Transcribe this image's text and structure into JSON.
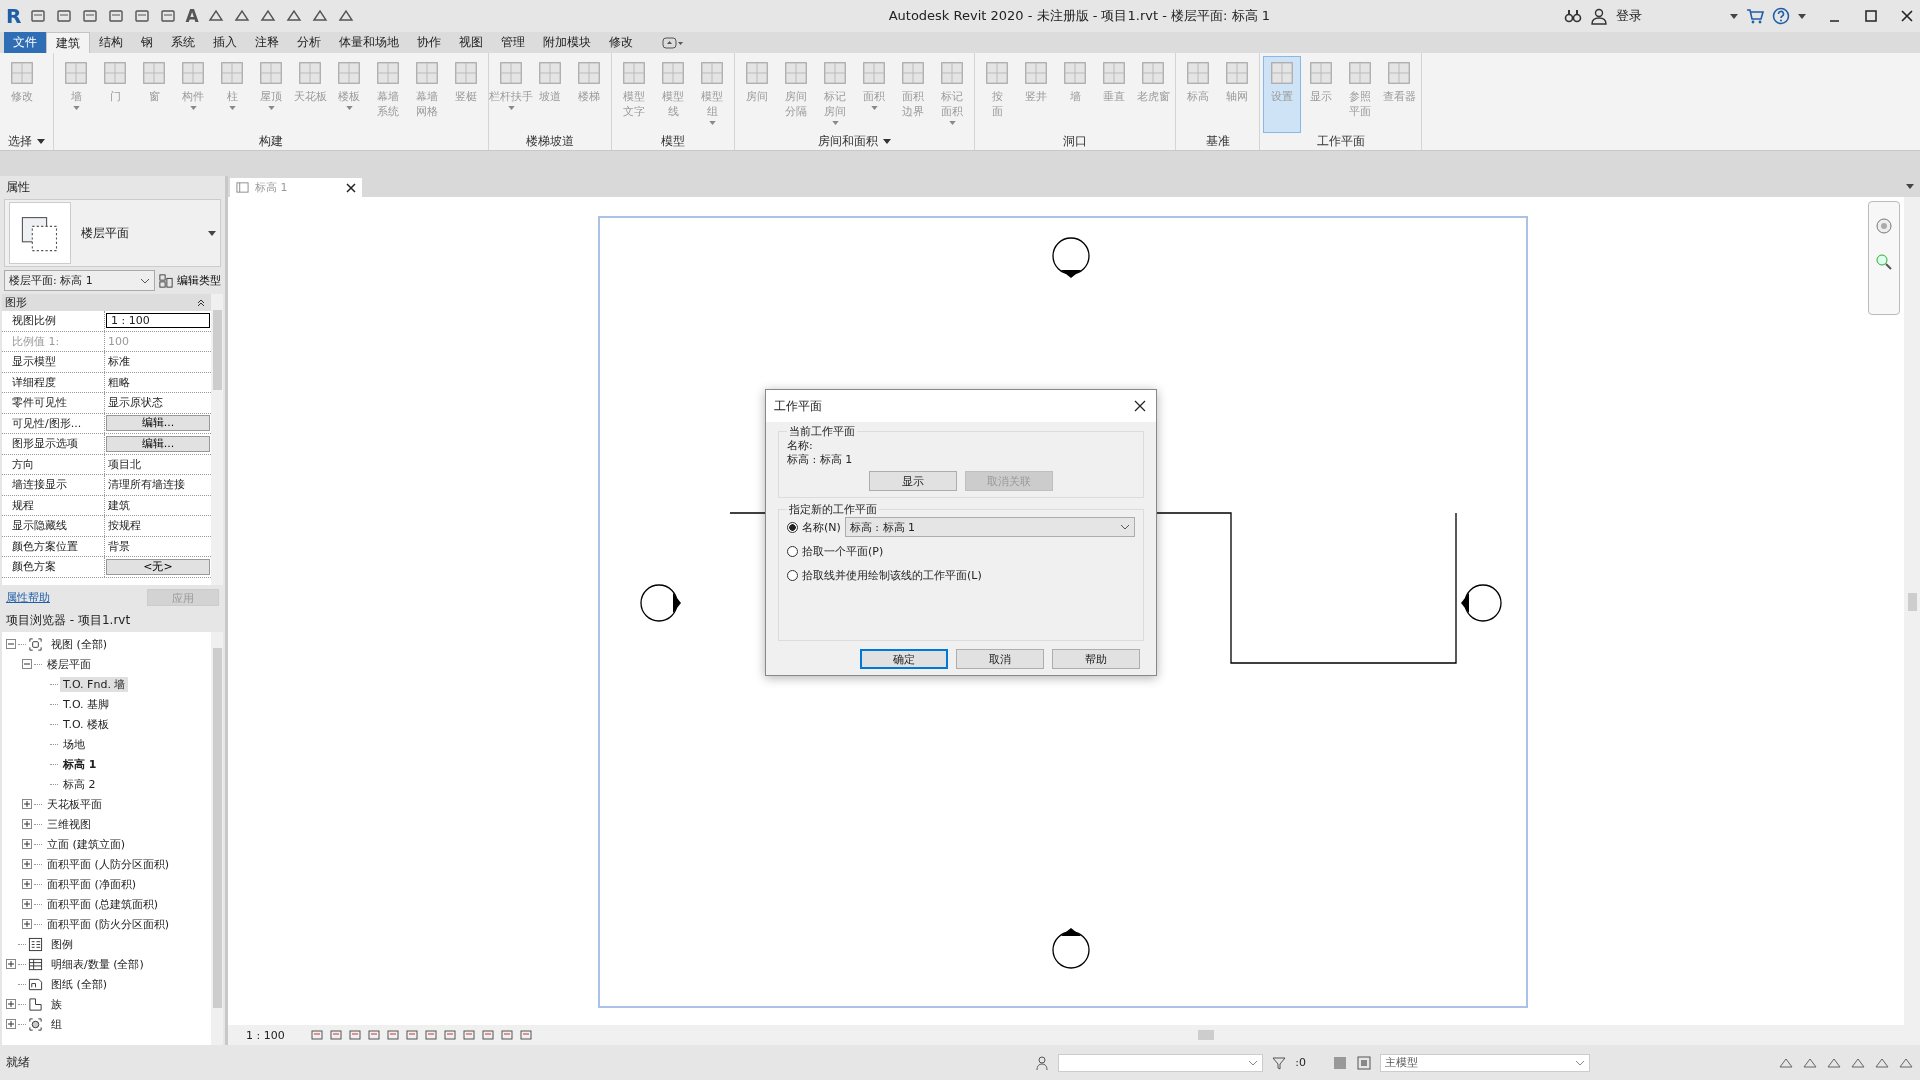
{
  "title_bar": {
    "logo": "R",
    "quick_text_tool": "A",
    "title": "Autodesk Revit 2020 - 未注册版 - 项目1.rvt - 楼层平面: 标高 1",
    "sign_in": "登录"
  },
  "menu_tabs": [
    {
      "label": "文件",
      "kind": "file",
      "selected": false
    },
    {
      "label": "建筑",
      "kind": "tab",
      "selected": true
    },
    {
      "label": "结构",
      "kind": "tab",
      "selected": false
    },
    {
      "label": "钢",
      "kind": "tab",
      "selected": false
    },
    {
      "label": "系统",
      "kind": "tab",
      "selected": false
    },
    {
      "label": "插入",
      "kind": "tab",
      "selected": false
    },
    {
      "label": "注释",
      "kind": "tab",
      "selected": false
    },
    {
      "label": "分析",
      "kind": "tab",
      "selected": false
    },
    {
      "label": "体量和场地",
      "kind": "tab",
      "selected": false
    },
    {
      "label": "协作",
      "kind": "tab",
      "selected": false
    },
    {
      "label": "视图",
      "kind": "tab",
      "selected": false
    },
    {
      "label": "管理",
      "kind": "tab",
      "selected": false
    },
    {
      "label": "附加模块",
      "kind": "tab",
      "selected": false
    },
    {
      "label": "修改",
      "kind": "tab",
      "selected": false
    }
  ],
  "ribbon": {
    "groups": [
      {
        "label": "选择",
        "dropdown": true,
        "tools": [
          {
            "lines": [
              "修改"
            ],
            "dropdown": false,
            "selected": false
          }
        ]
      },
      {
        "label": "构建",
        "dropdown": false,
        "tools": [
          {
            "lines": [
              "墙"
            ],
            "dropdown": true,
            "selected": false
          },
          {
            "lines": [
              "门"
            ],
            "dropdown": false,
            "selected": false
          },
          {
            "lines": [
              "窗"
            ],
            "dropdown": false,
            "selected": false
          },
          {
            "lines": [
              "构件"
            ],
            "dropdown": true,
            "selected": false
          },
          {
            "lines": [
              "柱"
            ],
            "dropdown": true,
            "selected": false
          },
          {
            "lines": [
              "屋顶"
            ],
            "dropdown": true,
            "selected": false
          },
          {
            "lines": [
              "天花板"
            ],
            "dropdown": false,
            "selected": false
          },
          {
            "lines": [
              "楼板"
            ],
            "dropdown": true,
            "selected": false
          },
          {
            "lines": [
              "幕墙",
              "系统"
            ],
            "dropdown": false,
            "selected": false
          },
          {
            "lines": [
              "幕墙",
              "网格"
            ],
            "dropdown": false,
            "selected": false
          },
          {
            "lines": [
              "竖梃"
            ],
            "dropdown": false,
            "selected": false
          }
        ]
      },
      {
        "label": "楼梯坡道",
        "dropdown": false,
        "tools": [
          {
            "lines": [
              "栏杆扶手"
            ],
            "dropdown": true,
            "selected": false
          },
          {
            "lines": [
              "坡道"
            ],
            "dropdown": false,
            "selected": false
          },
          {
            "lines": [
              "楼梯"
            ],
            "dropdown": false,
            "selected": false
          }
        ]
      },
      {
        "label": "模型",
        "dropdown": false,
        "tools": [
          {
            "lines": [
              "模型",
              "文字"
            ],
            "dropdown": false,
            "selected": false
          },
          {
            "lines": [
              "模型",
              "线"
            ],
            "dropdown": false,
            "selected": false
          },
          {
            "lines": [
              "模型",
              "组"
            ],
            "dropdown": true,
            "selected": false
          }
        ]
      },
      {
        "label": "房间和面积",
        "dropdown": true,
        "tools": [
          {
            "lines": [
              "房间"
            ],
            "dropdown": false,
            "selected": false
          },
          {
            "lines": [
              "房间",
              "分隔"
            ],
            "dropdown": false,
            "selected": false
          },
          {
            "lines": [
              "标记",
              "房间"
            ],
            "dropdown": true,
            "selected": false
          },
          {
            "lines": [
              "面积"
            ],
            "dropdown": true,
            "selected": false
          },
          {
            "lines": [
              "面积",
              "边界"
            ],
            "dropdown": false,
            "selected": false
          },
          {
            "lines": [
              "标记",
              "面积"
            ],
            "dropdown": true,
            "selected": false
          }
        ]
      },
      {
        "label": "洞口",
        "dropdown": false,
        "tools": [
          {
            "lines": [
              "按",
              "面"
            ],
            "dropdown": false,
            "selected": false
          },
          {
            "lines": [
              "竖井"
            ],
            "dropdown": false,
            "selected": false
          },
          {
            "lines": [
              "墙"
            ],
            "dropdown": false,
            "selected": false
          },
          {
            "lines": [
              "垂直"
            ],
            "dropdown": false,
            "selected": false
          },
          {
            "lines": [
              "老虎窗"
            ],
            "dropdown": false,
            "selected": false
          }
        ]
      },
      {
        "label": "基准",
        "dropdown": false,
        "tools": [
          {
            "lines": [
              "标高"
            ],
            "dropdown": false,
            "selected": false
          },
          {
            "lines": [
              "轴网"
            ],
            "dropdown": false,
            "selected": false
          }
        ]
      },
      {
        "label": "工作平面",
        "dropdown": false,
        "tools": [
          {
            "lines": [
              "设置"
            ],
            "dropdown": false,
            "selected": true
          },
          {
            "lines": [
              "显示"
            ],
            "dropdown": false,
            "selected": false
          },
          {
            "lines": [
              "参照",
              "平面"
            ],
            "dropdown": false,
            "selected": false
          },
          {
            "lines": [
              "查看器"
            ],
            "dropdown": false,
            "selected": false
          }
        ]
      }
    ]
  },
  "properties": {
    "title": "属性",
    "type_name": "楼层平面",
    "view_selector": "楼层平面: 标高 1",
    "edit_type": "编辑类型",
    "category": "图形",
    "rows": [
      {
        "name": "视图比例",
        "value": "1 : 100",
        "kind": "input"
      },
      {
        "name": "比例值 1:",
        "value": "100",
        "kind": "disabled"
      },
      {
        "name": "显示模型",
        "value": "标准",
        "kind": "text"
      },
      {
        "name": "详细程度",
        "value": "粗略",
        "kind": "text"
      },
      {
        "name": "零件可见性",
        "value": "显示原状态",
        "kind": "text"
      },
      {
        "name": "可见性/图形...",
        "value": "编辑...",
        "kind": "button"
      },
      {
        "name": "图形显示选项",
        "value": "编辑...",
        "kind": "button"
      },
      {
        "name": "方向",
        "value": "项目北",
        "kind": "text"
      },
      {
        "name": "墙连接显示",
        "value": "清理所有墙连接",
        "kind": "text"
      },
      {
        "name": "规程",
        "value": "建筑",
        "kind": "text"
      },
      {
        "name": "显示隐藏线",
        "value": "按规程",
        "kind": "text"
      },
      {
        "name": "颜色方案位置",
        "value": "背景",
        "kind": "text"
      },
      {
        "name": "颜色方案",
        "value": "<无>",
        "kind": "button"
      }
    ],
    "help_link": "属性帮助",
    "apply": "应用"
  },
  "project_browser": {
    "title": "项目浏览器 - 项目1.rvt",
    "tree": [
      {
        "label": "视图 (全部)",
        "kind": "views",
        "expanded": true,
        "children": [
          {
            "label": "楼层平面",
            "expanded": true,
            "children": [
              {
                "label": "T.O. Fnd. 墙",
                "selected": true,
                "current": false
              },
              {
                "label": "T.O. 基脚",
                "selected": false,
                "current": false
              },
              {
                "label": "T.O. 楼板",
                "selected": false,
                "current": false
              },
              {
                "label": "场地",
                "selected": false,
                "current": false
              },
              {
                "label": "标高 1",
                "selected": false,
                "current": true
              },
              {
                "label": "标高 2",
                "selected": false,
                "current": false
              }
            ]
          },
          {
            "label": "天花板平面",
            "expanded": false
          },
          {
            "label": "三维视图",
            "expanded": false
          },
          {
            "label": "立面 (建筑立面)",
            "expanded": false
          },
          {
            "label": "面积平面 (人防分区面积)",
            "expanded": false
          },
          {
            "label": "面积平面 (净面积)",
            "expanded": false
          },
          {
            "label": "面积平面 (总建筑面积)",
            "expanded": false
          },
          {
            "label": "面积平面 (防火分区面积)",
            "expanded": false
          }
        ]
      },
      {
        "label": "图例",
        "kind": "legend"
      },
      {
        "label": "明细表/数量 (全部)",
        "kind": "schedule",
        "expanded": false
      },
      {
        "label": "图纸 (全部)",
        "kind": "sheet"
      },
      {
        "label": "族",
        "kind": "family",
        "expanded": false
      },
      {
        "label": "组",
        "kind": "group",
        "expanded": false
      }
    ]
  },
  "view_tab": {
    "title": "标高 1"
  },
  "view_bar": {
    "scale": "1 : 100"
  },
  "dialog": {
    "title": "工作平面",
    "current_group": "当前工作平面",
    "name_label": "名称:",
    "current_name": "标高 : 标高 1",
    "current_buttons": [
      {
        "label": "显示",
        "disabled": false
      },
      {
        "label": "取消关联",
        "disabled": true
      }
    ],
    "new_group": "指定新的工作平面",
    "options": [
      {
        "label": "名称(N)",
        "selected": true
      },
      {
        "label": "拾取一个平面(P)",
        "selected": false
      },
      {
        "label": "拾取线并使用绘制该线的工作平面(L)",
        "selected": false
      }
    ],
    "name_select": "标高 : 标高 1",
    "buttons": [
      {
        "label": "确定",
        "default": true
      },
      {
        "label": "取消",
        "default": false
      },
      {
        "label": "帮助",
        "default": false
      }
    ]
  },
  "status_bar": {
    "status": "就绪",
    "count": ":0",
    "model": "主模型"
  }
}
